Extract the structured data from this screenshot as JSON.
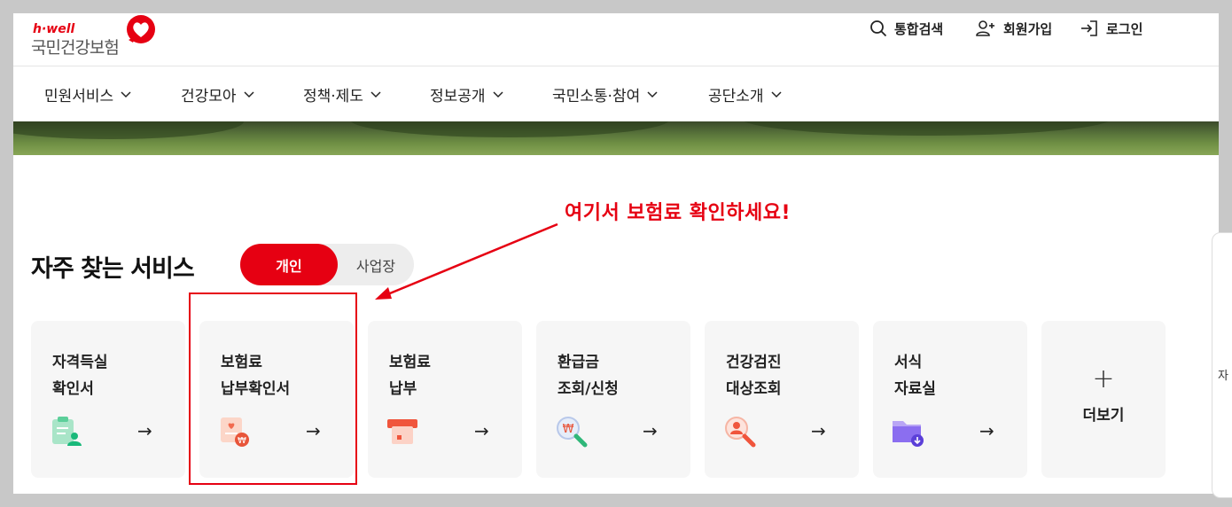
{
  "logo": {
    "en": "h·well",
    "ko": "국민건강보험"
  },
  "util": {
    "search": "통합검색",
    "join": "회원가입",
    "login": "로그인"
  },
  "nav": [
    "민원서비스",
    "건강모아",
    "정책·제도",
    "정보공개",
    "국민소통·참여",
    "공단소개"
  ],
  "annotation": "여기서 보험료 확인하세요!",
  "section": {
    "title": "자주 찾는 서비스",
    "toggle_on": "개인",
    "toggle_off": "사업장"
  },
  "cards": [
    {
      "line1": "자격득실",
      "line2": "확인서",
      "icon": "clipboard-person-icon"
    },
    {
      "line1": "보험료",
      "line2": "납부확인서",
      "icon": "won-certificate-icon"
    },
    {
      "line1": "보험료",
      "line2": "납부",
      "icon": "card-payment-icon"
    },
    {
      "line1": "환급금",
      "line2": "조회/신청",
      "icon": "won-search-icon"
    },
    {
      "line1": "건강검진",
      "line2": "대상조회",
      "icon": "person-search-icon"
    },
    {
      "line1": "서식",
      "line2": "자료실",
      "icon": "folder-download-icon"
    }
  ],
  "more": {
    "label": "더보기"
  },
  "side_tab": {
    "label": "자"
  },
  "colors": {
    "brand": "#e60012",
    "card_bg": "#f6f6f6"
  }
}
